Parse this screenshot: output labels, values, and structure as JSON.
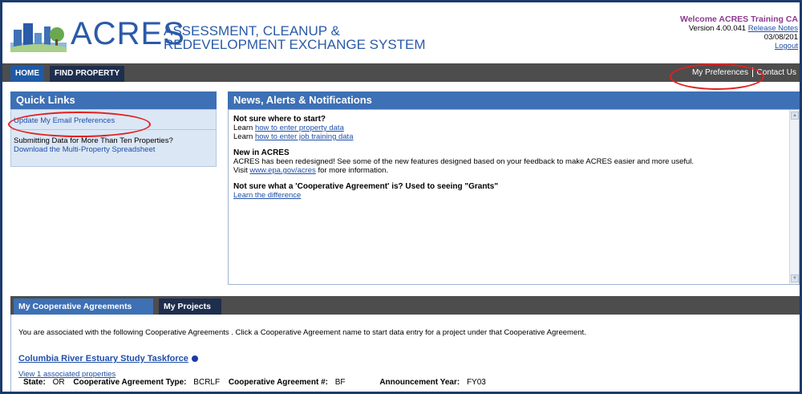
{
  "header": {
    "brand": "ACRES",
    "brand_subtitle_line1": "ASSESSMENT, CLEANUP &",
    "brand_subtitle_line2": "REDEVELOPMENT EXCHANGE SYSTEM",
    "welcome": "Welcome ACRES Training CA",
    "version_text": "Version 4.00.041",
    "release_notes": "Release Notes",
    "date": "03/08/201",
    "logout": "Logout"
  },
  "nav": {
    "home": "HOME",
    "find_property": "FIND PROPERTY",
    "my_preferences": "My Preferences",
    "contact_us": "Contact Us"
  },
  "quick_links": {
    "title": "Quick Links",
    "update_email": "Update My Email Preferences",
    "submitting_text": "Submitting Data for More Than Ten Properties?",
    "download_link": "Download the Multi-Property Spreadsheet"
  },
  "news": {
    "title": "News, Alerts & Notifications",
    "block1_title": "Not sure where to start?",
    "learn1_prefix": "Learn",
    "learn1_link": "how to enter property data",
    "learn2_prefix": "Learn",
    "learn2_link": "how to enter job training data",
    "block2_title": "New in ACRES",
    "block2_text": "ACRES has been redesigned! See some of the new features designed based on your feedback to make ACRES easier and more useful.",
    "visit_prefix": "Visit",
    "visit_link": "www.epa.gov/acres",
    "visit_suffix": "for more information.",
    "block3_title": "Not sure what a 'Cooperative Agreement' is? Used to seeing \"Grants\"",
    "block3_link": "Learn the difference"
  },
  "tabs": {
    "coop": "My Cooperative Agreements",
    "projects": "My Projects"
  },
  "main": {
    "intro": "You are associated with the following Cooperative Agreements . Click a Cooperative Agreement name to start data entry for a project under that Cooperative Agreement.",
    "ca_name": "Columbia River Estuary Study Taskforce",
    "associated": "View 1 associated properties",
    "state_label": "State:",
    "state_value": "OR",
    "type_label": "Cooperative Agreement Type:",
    "type_value": "BCRLF",
    "number_label": "Cooperative Agreement #:",
    "number_value": "BF",
    "year_label": "Announcement Year:",
    "year_value": "FY03"
  },
  "colors": {
    "accent_blue": "#3d70b5",
    "nav_dark": "#4d4d4d",
    "brand_blue": "#2a5aa8",
    "welcome_purple": "#8b3a8f",
    "annotation_red": "#e02020"
  }
}
